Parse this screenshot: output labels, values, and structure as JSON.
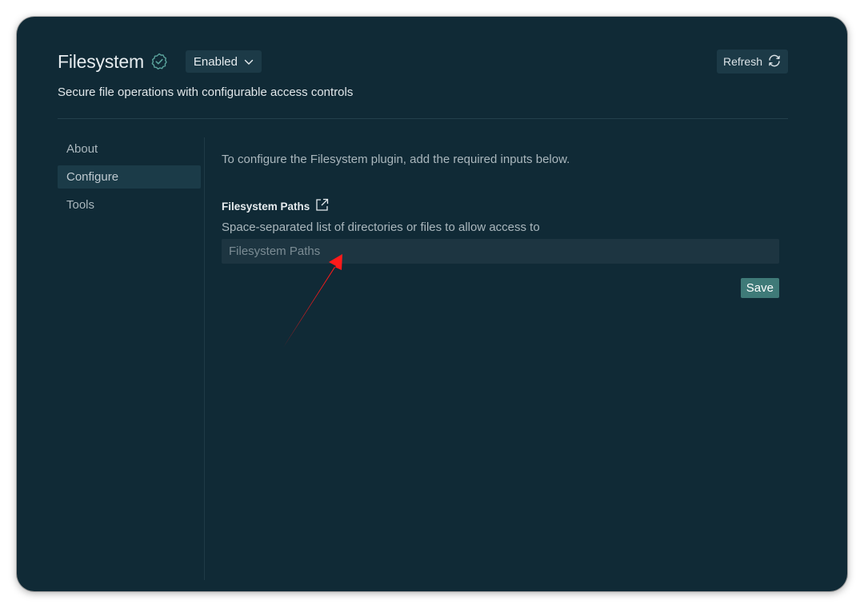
{
  "plugin": {
    "title": "Filesystem",
    "status": "Enabled",
    "description": "Secure file operations with configurable access controls"
  },
  "header": {
    "refresh_label": "Refresh"
  },
  "sidebar": {
    "items": [
      {
        "label": "About",
        "active": false
      },
      {
        "label": "Configure",
        "active": true
      },
      {
        "label": "Tools",
        "active": false
      }
    ]
  },
  "configure": {
    "intro": "To configure the Filesystem plugin, add the required inputs below.",
    "field": {
      "label": "Filesystem Paths",
      "description": "Space-separated list of directories or files to allow access to",
      "placeholder": "Filesystem Paths",
      "value": ""
    },
    "save_label": "Save"
  },
  "icons": {
    "verified": "verified-badge-icon",
    "dropdown": "chevron-down-icon",
    "refresh": "refresh-icon",
    "external_link": "external-link-icon",
    "annotation": "red-arrow-annotation"
  },
  "colors": {
    "background": "#102a36",
    "panel": "#1c3a47",
    "accent": "#3f7a78",
    "annotation": "#ff1a1a"
  }
}
